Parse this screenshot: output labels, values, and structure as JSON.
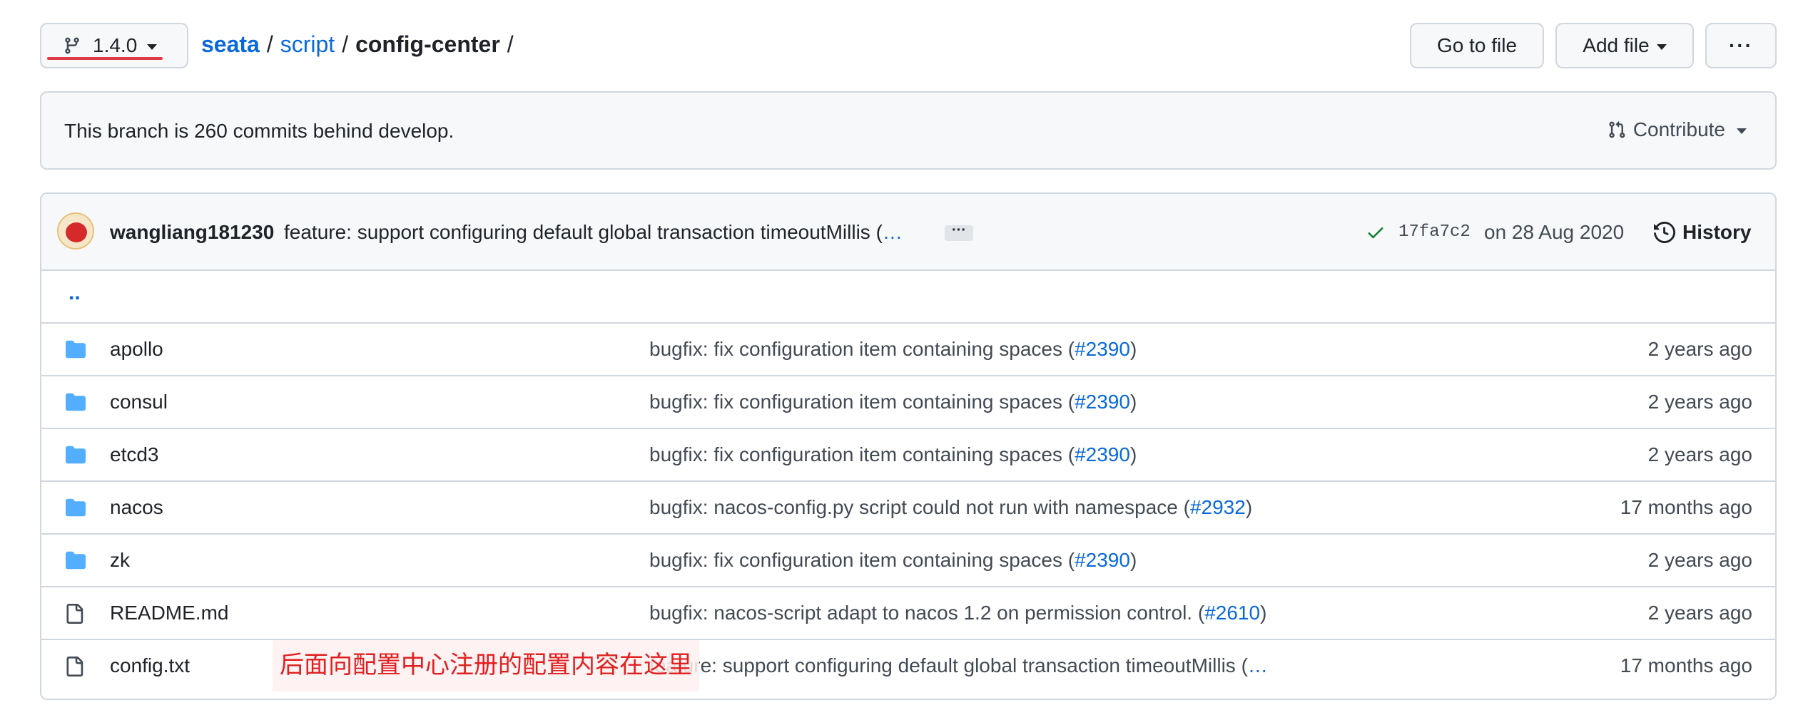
{
  "topbar": {
    "branch": "1.4.0",
    "breadcrumb": {
      "repo": "seata",
      "dir": "script",
      "current": "config-center",
      "sep": "/"
    },
    "go_to_file": "Go to file",
    "add_file": "Add file",
    "more": "···"
  },
  "info": {
    "text": "This branch is 260 commits behind develop.",
    "contribute": "Contribute"
  },
  "commit": {
    "author": "wangliang181230",
    "message": "feature: support configuring default global transaction timeoutMillis (",
    "message_more": "…",
    "ellipsis": "···",
    "sha": "17fa7c2",
    "date": "on 28 Aug 2020",
    "history": "History"
  },
  "updir": "..",
  "files": [
    {
      "type": "folder",
      "name": "apollo",
      "msg": "bugfix: fix configuration item containing spaces (",
      "ref": "#2390",
      "tail": ")",
      "age": "2 years ago"
    },
    {
      "type": "folder",
      "name": "consul",
      "msg": "bugfix: fix configuration item containing spaces (",
      "ref": "#2390",
      "tail": ")",
      "age": "2 years ago"
    },
    {
      "type": "folder",
      "name": "etcd3",
      "msg": "bugfix: fix configuration item containing spaces (",
      "ref": "#2390",
      "tail": ")",
      "age": "2 years ago"
    },
    {
      "type": "folder",
      "name": "nacos",
      "msg": "bugfix: nacos-config.py script could not run with namespace (",
      "ref": "#2932",
      "tail": ")",
      "age": "17 months ago"
    },
    {
      "type": "folder",
      "name": "zk",
      "msg": "bugfix: fix configuration item containing spaces (",
      "ref": "#2390",
      "tail": ")",
      "age": "2 years ago"
    },
    {
      "type": "file",
      "name": "README.md",
      "msg": "bugfix: nacos-script adapt to nacos 1.2 on permission control. (",
      "ref": "#2610",
      "tail": ")",
      "age": "2 years ago"
    },
    {
      "type": "file",
      "name": "config.txt",
      "msg": "feature: support configuring default global transaction timeoutMillis (",
      "ref": "…",
      "tail": "",
      "age": "17 months ago"
    }
  ],
  "annotation": "后面向配置中心注册的配置内容在这里",
  "colors": {
    "link": "#0969da",
    "annotation": "#e02020",
    "folder": "#54aeff",
    "underline": "#e03a4a"
  }
}
